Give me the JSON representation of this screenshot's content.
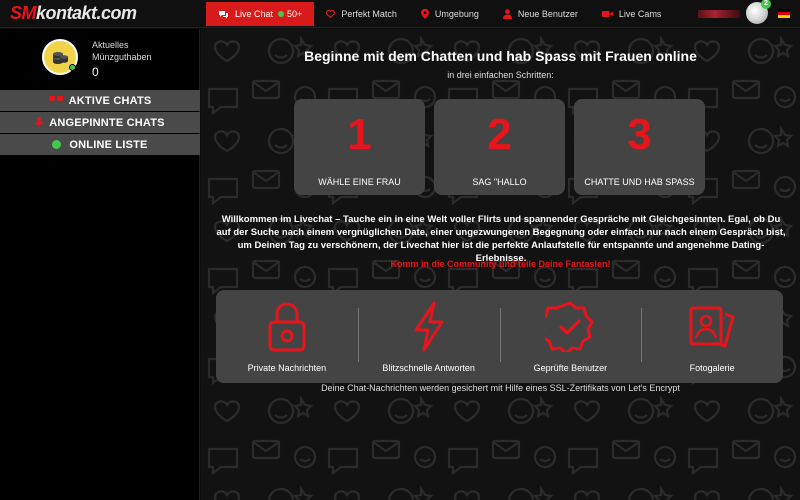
{
  "brand": {
    "logo_prefix": "SM",
    "logo_suffix": "kontakt.com"
  },
  "nav": {
    "items": [
      {
        "label": "Live Chat",
        "count": "50+",
        "icon": "chat-icon",
        "active": true
      },
      {
        "label": "Perfekt Match",
        "icon": "heart-icon"
      },
      {
        "label": "Umgebung",
        "icon": "location-pin-icon"
      },
      {
        "label": "Neue Benutzer",
        "icon": "user-icon"
      },
      {
        "label": "Live Cams",
        "icon": "video-camera-icon"
      }
    ],
    "notification_count": "2",
    "language_flag": "german-flag-icon"
  },
  "sidebar": {
    "balance_label": "Aktuelles Münzguthaben",
    "balance_value": "0",
    "menu": [
      {
        "label": "AKTIVE CHATS",
        "icon": "chats-icon"
      },
      {
        "label": "ANGEPINNTE CHATS",
        "icon": "pin-icon"
      },
      {
        "label": "ONLINE LISTE",
        "icon": "online-status-icon"
      }
    ]
  },
  "main": {
    "title": "Beginne mit dem Chatten und hab Spass mit Frauen online",
    "subtitle": "in drei einfachen Schritten:",
    "steps": [
      {
        "number": "1",
        "label": "WÄHLE EINE FRAU"
      },
      {
        "number": "2",
        "label": "SAG \"HALLO"
      },
      {
        "number": "3",
        "label": "CHATTE UND HAB SPASS"
      }
    ],
    "intro": "Willkommen im Livechat – Tauche ein in eine Welt voller Flirts und spannender Gespräche mit Gleichgesinnten. Egal, ob Du auf der Suche nach einem vergnüglichen Date, einer ungezwungenen Begegnung oder einfach nur nach einem Gespräch bist, um Deinen Tag zu verschönern, der Livechat hier ist die perfekte Anlaufstelle für entspannte und angenehme Dating-Erlebnisse.",
    "cta": "Komm in die Community und teile Deine Fantasien!",
    "features": [
      {
        "label": "Private Nachrichten",
        "icon": "lock-icon"
      },
      {
        "label": "Blitzschnelle Antworten",
        "icon": "lightning-icon"
      },
      {
        "label": "Geprüfte Benutzer",
        "icon": "verified-badge-icon"
      },
      {
        "label": "Fotogalerie",
        "icon": "photo-gallery-icon"
      }
    ],
    "ssl_note": "Deine Chat-Nachrichten werden gesichert mit Hilfe eines SSL-Zertifikats von Let's Encrypt"
  },
  "colors": {
    "accent_red": "#e8141b",
    "nav_active": "#d81a1a",
    "panel_gray": "#444444",
    "online_green": "#43c84c",
    "coin_gold": "#f1d34a"
  }
}
